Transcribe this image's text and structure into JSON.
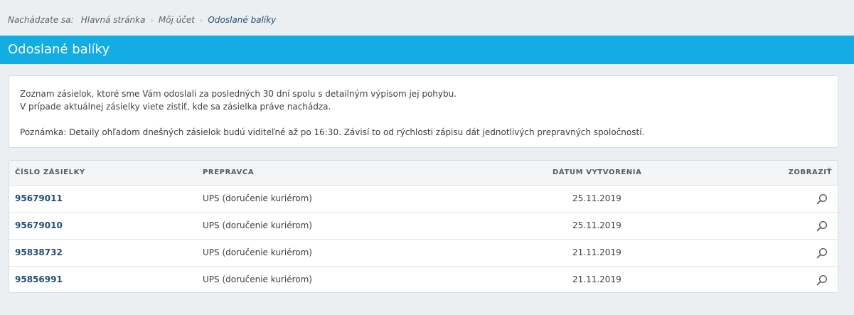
{
  "breadcrumb": {
    "prefix": "Nachádzate sa:",
    "items": [
      "Hlavná stránka",
      "Môj účet",
      "Odoslané balíky"
    ]
  },
  "page_title": "Odoslané balíky",
  "info": {
    "line1": "Zoznam zásielok, ktoré sme Vám odoslali za posledných 30 dní spolu s detailným výpisom jej pohybu.",
    "line2": "V prípade aktuálnej zásielky viete zistiť, kde sa zásielka práve nachádza.",
    "note": "Poznámka: Detaily ohľadom dnešných zásielok budú viditeľné až po 16:30. Závisí to od rýchlosti zápisu dát jednotlivých prepravných spoločností."
  },
  "table": {
    "headers": [
      "ČÍSLO ZÁSIELKY",
      "PREPRAVCA",
      "DÁTUM VYTVORENIA",
      "ZOBRAZIŤ"
    ],
    "rows": [
      {
        "number": "95679011",
        "carrier": "UPS (doručenie kuriérom)",
        "date": "25.11.2019"
      },
      {
        "number": "95679010",
        "carrier": "UPS (doručenie kuriérom)",
        "date": "25.11.2019"
      },
      {
        "number": "95838732",
        "carrier": "UPS (doručenie kuriérom)",
        "date": "21.11.2019"
      },
      {
        "number": "95856991",
        "carrier": "UPS (doručenie kuriérom)",
        "date": "21.11.2019"
      }
    ]
  },
  "colors": {
    "title_bar": "#11ade3",
    "link": "#1f4e79",
    "background": "#eceff1"
  }
}
